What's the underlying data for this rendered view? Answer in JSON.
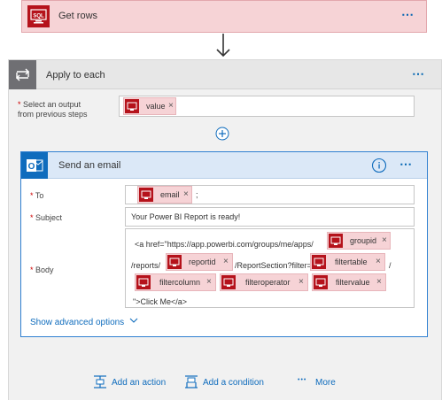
{
  "get_rows": {
    "title": "Get rows",
    "icon": "sql-database-icon",
    "icon_text": "SQL",
    "menu": "⋯"
  },
  "connector_arrow": "down-arrow-icon",
  "apply_each": {
    "title": "Apply to each",
    "icon": "loop-icon",
    "menu": "⋯",
    "select_label": "Select an output from previous steps",
    "select_label_line1": "Select an output",
    "select_label_line2": "from previous steps",
    "select_token": "value",
    "add_icon": "plus-circle-icon"
  },
  "email": {
    "title": "Send an email",
    "icon": "outlook-icon",
    "info_icon": "info-icon",
    "menu": "⋯",
    "to_label": "To",
    "to_token": "email",
    "to_suffix": ";",
    "subject_label": "Subject",
    "subject_value": "Your Power BI Report is ready!",
    "body_label": "Body",
    "body": {
      "text1": "<a href=\"https://app.powerbi.com/groups/me/apps/",
      "token1": "groupid",
      "text2": "/reports/",
      "token2": "reportid",
      "text3": "/ReportSection?filter=",
      "token3": "filtertable",
      "text4": "/",
      "token4": "filtercolumn",
      "token5": "filteroperator",
      "token6": "filtervalue",
      "text5": "\">Click Me</a>"
    },
    "advanced": "Show advanced options",
    "remove_glyph": "×",
    "required_mark": "*"
  },
  "footer": {
    "add_action": "Add an action",
    "add_condition": "Add a condition",
    "more": "More",
    "more_dots": "•••"
  },
  "colors": {
    "sql_red": "#b5121b",
    "outlook_blue": "#0f6cbd",
    "link_blue": "#0063b1",
    "token_bg": "#f6d3d6"
  }
}
